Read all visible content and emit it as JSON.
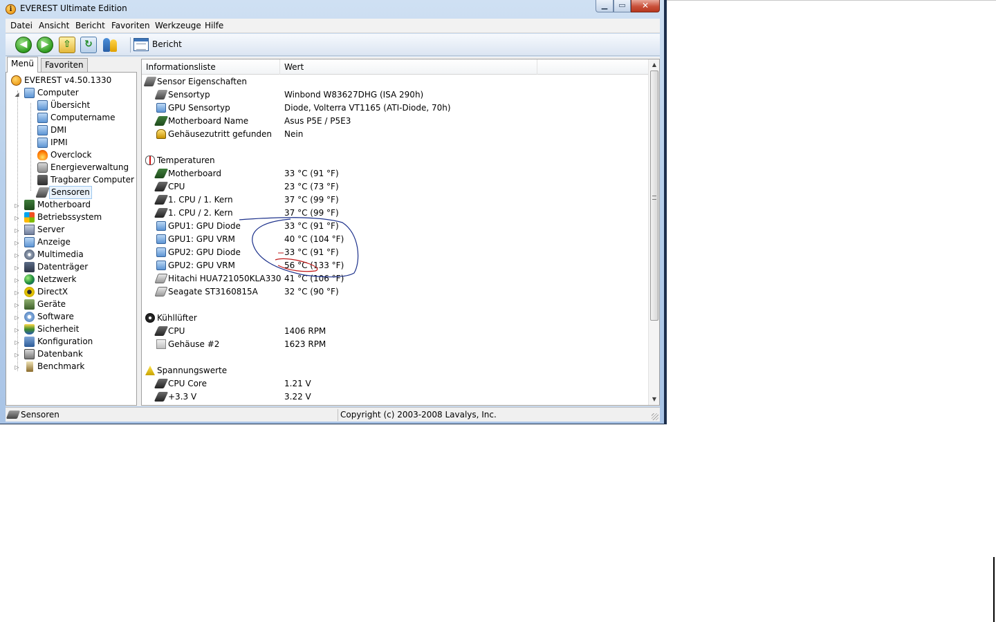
{
  "window": {
    "title": "EVEREST Ultimate Edition",
    "app_icon": "info-icon",
    "controls": [
      "minimize-icon",
      "maximize-icon",
      "close-icon"
    ]
  },
  "menu": {
    "items": [
      "Datei",
      "Ansicht",
      "Bericht",
      "Favoriten",
      "Werkzeuge",
      "Hilfe"
    ]
  },
  "toolbar": {
    "report_label": "Bericht",
    "buttons": [
      "back-arrow-icon",
      "forward-arrow-icon",
      "up-folder-icon",
      "refresh-icon",
      "users-icon",
      "report-icon"
    ]
  },
  "sidebar": {
    "tabs": [
      "Menü",
      "Favoriten"
    ],
    "root": "EVEREST v4.50.1330",
    "computer": {
      "label": "Computer",
      "children": [
        "Übersicht",
        "Computername",
        "DMI",
        "IPMI",
        "Overclock",
        "Energieverwaltung",
        "Tragbarer Computer",
        "Sensoren"
      ]
    },
    "categories": [
      "Motherboard",
      "Betriebssystem",
      "Server",
      "Anzeige",
      "Multimedia",
      "Datenträger",
      "Netzwerk",
      "DirectX",
      "Geräte",
      "Software",
      "Sicherheit",
      "Konfiguration",
      "Datenbank",
      "Benchmark"
    ],
    "selected": "Sensoren"
  },
  "table": {
    "headers": [
      "Informationsliste",
      "Wert"
    ],
    "groups": [
      {
        "title": "Sensor Eigenschaften",
        "icon": "sensor-chip-icon",
        "rows": [
          {
            "field": "Sensortyp",
            "value": "Winbond W83627DHG  (ISA 290h)",
            "icon": "sensor-chip-icon"
          },
          {
            "field": "GPU Sensortyp",
            "value": "Diode, Volterra VT1165  (ATI-Diode, 70h)",
            "icon": "monitor-icon"
          },
          {
            "field": "Motherboard Name",
            "value": "Asus P5E / P5E3",
            "icon": "motherboard-icon"
          },
          {
            "field": "Gehäusezutritt gefunden",
            "value": "Nein",
            "icon": "lock-icon"
          }
        ]
      },
      {
        "title": "Temperaturen",
        "icon": "thermometer-icon",
        "rows": [
          {
            "field": "Motherboard",
            "value": "33 °C  (91 °F)",
            "icon": "motherboard-icon"
          },
          {
            "field": "CPU",
            "value": "23 °C  (73 °F)",
            "icon": "cpu-icon"
          },
          {
            "field": "1. CPU / 1. Kern",
            "value": "37 °C  (99 °F)",
            "icon": "cpu-icon"
          },
          {
            "field": "1. CPU / 2. Kern",
            "value": "37 °C  (99 °F)",
            "icon": "cpu-icon"
          },
          {
            "field": "GPU1: GPU Diode",
            "value": "33 °C  (91 °F)",
            "icon": "monitor-icon"
          },
          {
            "field": "GPU1: GPU VRM",
            "value": "40 °C  (104 °F)",
            "icon": "monitor-icon"
          },
          {
            "field": "GPU2: GPU Diode",
            "value": "33 °C  (91 °F)",
            "icon": "monitor-icon"
          },
          {
            "field": "GPU2: GPU VRM",
            "value": "56 °C  (133 °F)",
            "icon": "monitor-icon"
          },
          {
            "field": "Hitachi HUA721050KLA330",
            "value": "41 °C  (106 °F)",
            "icon": "harddisk-icon"
          },
          {
            "field": "Seagate ST3160815A",
            "value": "32 °C  (90 °F)",
            "icon": "harddisk-icon"
          }
        ]
      },
      {
        "title": "Kühllüfter",
        "icon": "fan-icon",
        "rows": [
          {
            "field": "CPU",
            "value": "1406 RPM",
            "icon": "cpu-icon"
          },
          {
            "field": "Gehäuse #2",
            "value": "1623 RPM",
            "icon": "case-icon"
          }
        ]
      },
      {
        "title": "Spannungswerte",
        "icon": "voltage-warning-icon",
        "rows": [
          {
            "field": "CPU Core",
            "value": "1.21 V",
            "icon": "cpu-icon"
          },
          {
            "field": "+3.3 V",
            "value": "3.22 V",
            "icon": "cpu-icon"
          }
        ]
      }
    ]
  },
  "status": {
    "left": "Sensoren",
    "right": "Copyright (c) 2003-2008 Lavalys, Inc."
  },
  "colors": {
    "annotation_blue": "#1a2f8a",
    "annotation_red": "#c01818",
    "selection": "#eaf3fc"
  }
}
